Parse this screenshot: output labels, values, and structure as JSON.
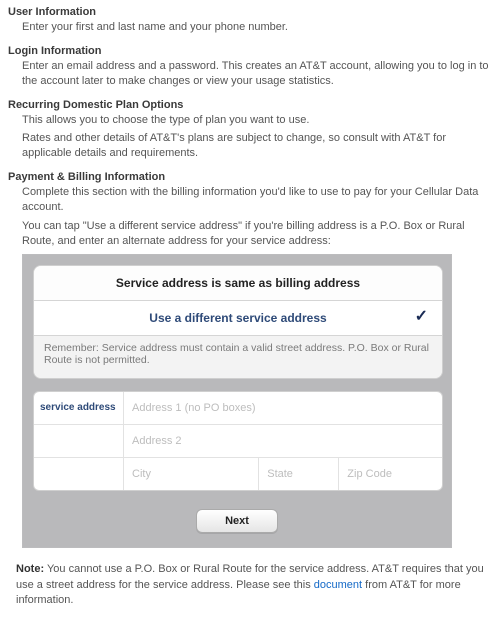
{
  "sections": {
    "user_info": {
      "heading": "User Information",
      "body": "Enter your first and last name and your phone number."
    },
    "login_info": {
      "heading": "Login Information",
      "body": "Enter an email address and a password. This creates an AT&T account, allowing you to log in to the account later to make changes or view your usage statistics."
    },
    "plan_opts": {
      "heading": "Recurring Domestic Plan Options",
      "body1": "This allows you to choose the type of plan you want to use.",
      "body2": "Rates and other details of AT&T's plans are subject to change, so consult with AT&T for applicable details and requirements."
    },
    "payment": {
      "heading": "Payment & Billing Information",
      "body1": "Complete this section with the billing information you'd like to use to pay for your Cellular Data account.",
      "body2": "You can tap \"Use a different service address\" if you're billing address is a P.O. Box or Rural Route, and enter an alternate address for your service address:"
    }
  },
  "panel": {
    "title": "Service address is same as billing address",
    "alt_option": "Use a different service address",
    "note": "Remember: Service address must contain a valid street address. P.O. Box or Rural Route is not permitted."
  },
  "form": {
    "label": "service address",
    "addr1_ph": "Address 1 (no PO boxes)",
    "addr2_ph": "Address 2",
    "city_ph": "City",
    "state_ph": "State",
    "zip_ph": "Zip Code",
    "next": "Next"
  },
  "footer": {
    "bold": "Note:",
    "pre": " You cannot use a P.O. Box or Rural Route for the service address. AT&T requires that you use a street address for the service address. Please see this ",
    "link": "document",
    "post": " from AT&T for more information."
  }
}
